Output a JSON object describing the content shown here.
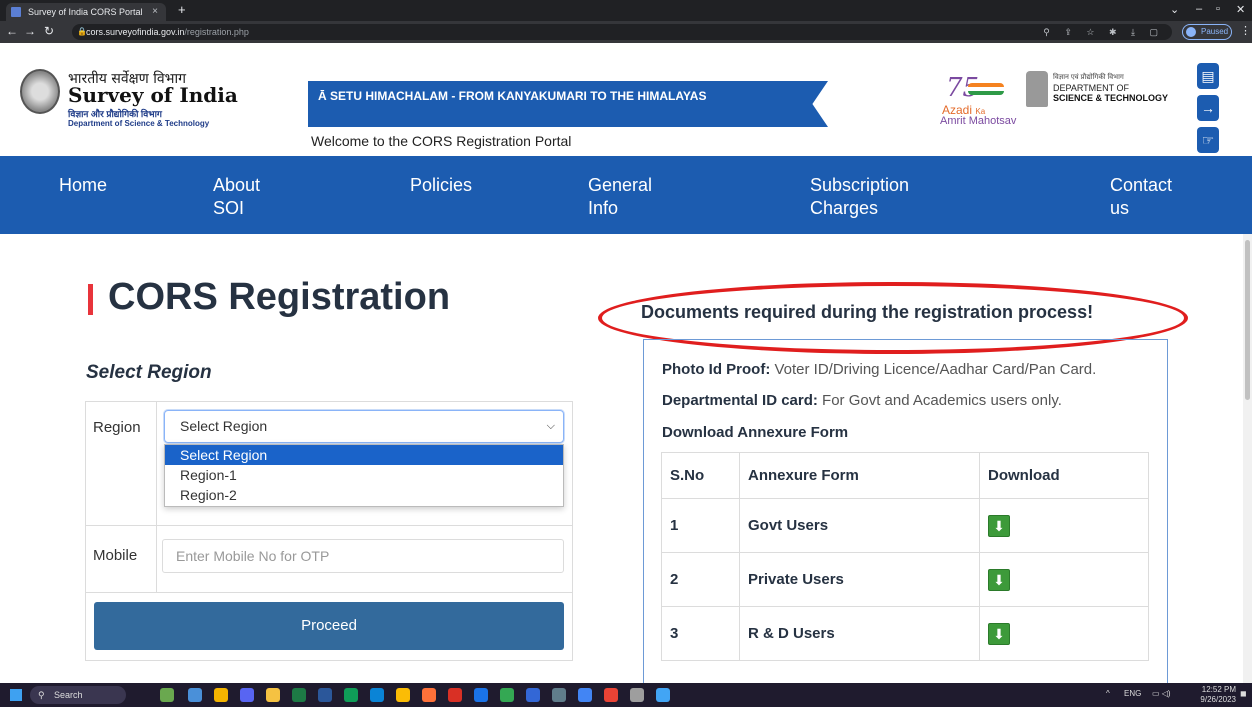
{
  "browser": {
    "tab_title": "Survey of India CORS Portal",
    "tab_close": "×",
    "new_tab": "+",
    "url_domain": "cors.surveyofindia.gov.in",
    "url_path": "/registration.php",
    "profile_status": "Paused"
  },
  "header": {
    "org_hindi": "भारतीय सर्वेक्षण विभाग",
    "org_name": "Survey of India",
    "org_hindi_dept": "विज्ञान और प्रौद्योगिकी विभाग",
    "org_dept": "Department of Science & Technology",
    "banner_text": "Ā SETU HIMACHALAM - FROM KANYAKUMARI TO THE HIMALAYAS",
    "welcome": "Welcome to the CORS Registration Portal",
    "azadi_line1": "Azadi",
    "azadi_ka": "Ka",
    "azadi_line2": "Amrit Mahotsav",
    "dst_hindi": "विज्ञान एवं प्रौद्योगिकी विभाग",
    "dst_line1": "DEPARTMENT OF",
    "dst_line2": "SCIENCE & TECHNOLOGY"
  },
  "nav": {
    "items": [
      {
        "label": "Home"
      },
      {
        "label": "About SOI"
      },
      {
        "label": "Policies"
      },
      {
        "label": "General Info"
      },
      {
        "label": "Subscription Charges"
      },
      {
        "label": "Contact us"
      }
    ]
  },
  "main": {
    "title": "CORS Registration",
    "section_heading": "Select Region",
    "region_label": "Region",
    "region_selected": "Select Region",
    "region_options": [
      "Select Region",
      "Region-1",
      "Region-2"
    ],
    "mobile_label": "Mobile",
    "mobile_placeholder": "Enter Mobile No for OTP",
    "proceed_label": "Proceed"
  },
  "docs": {
    "title": "Documents required during the registration process!",
    "photo_id_label": "Photo Id Proof:",
    "photo_id_text": " Voter ID/Driving Licence/Aadhar Card/Pan Card.",
    "dept_id_label": "Departmental ID card:",
    "dept_id_text": " For Govt and Academics users only.",
    "annexure_heading": "Download Annexure Form",
    "table_headers": [
      "S.No",
      "Annexure Form",
      "Download"
    ],
    "rows": [
      {
        "sno": "1",
        "form": "Govt Users"
      },
      {
        "sno": "2",
        "form": "Private Users"
      },
      {
        "sno": "3",
        "form": "R & D Users"
      }
    ]
  },
  "taskbar": {
    "search_label": "Search",
    "lang": "ENG",
    "time": "12:52 PM",
    "date": "9/26/2023"
  },
  "colors": {
    "brand_blue": "#1c5cb0",
    "accent_red": "#e8343b",
    "button_blue": "#336a9c",
    "annotation_red": "#e01e1e"
  }
}
